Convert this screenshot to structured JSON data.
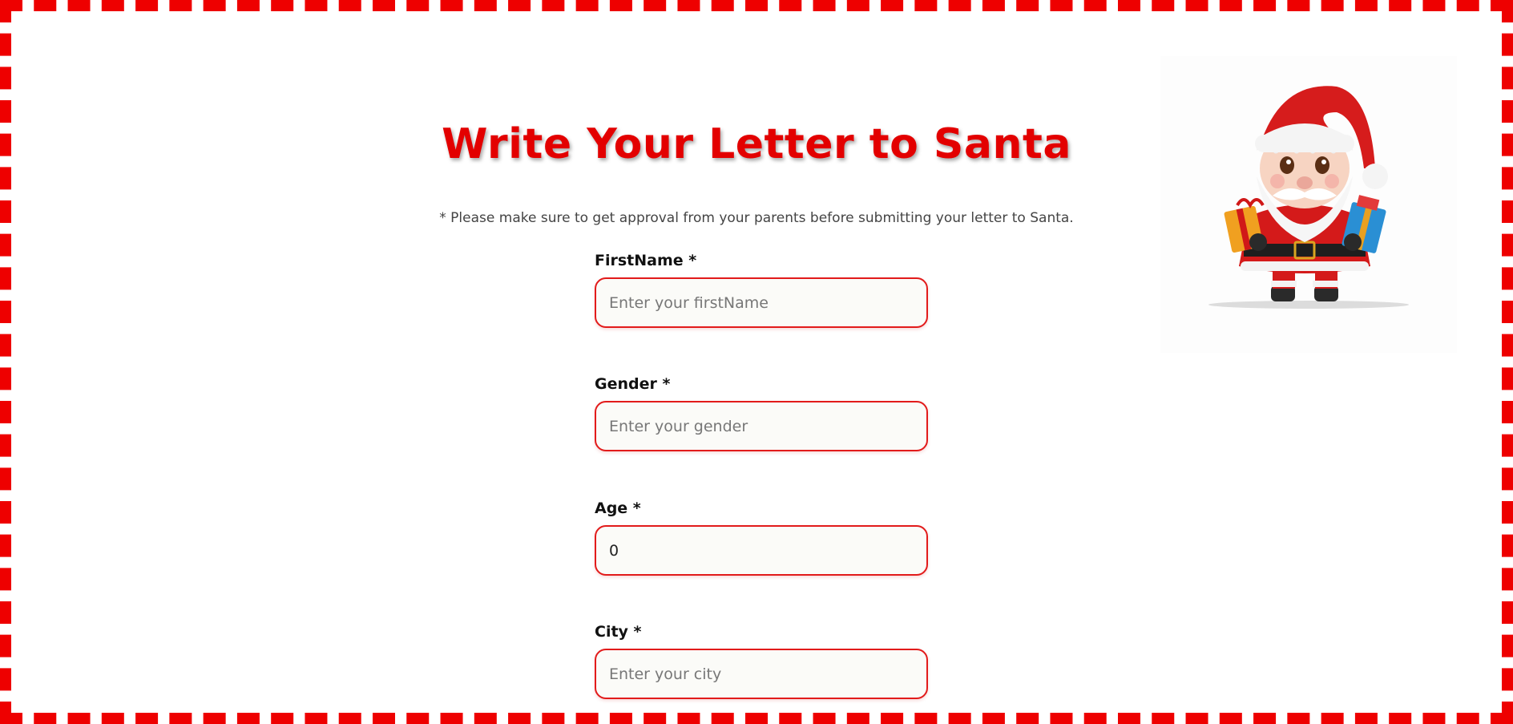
{
  "page": {
    "title": "Write Your Letter to Santa",
    "notice": "* Please make sure to get approval from your parents before submitting your letter to Santa."
  },
  "form": {
    "firstname": {
      "label": "FirstName *",
      "placeholder": "Enter your firstName",
      "value": ""
    },
    "gender": {
      "label": "Gender *",
      "placeholder": "Enter your gender",
      "value": ""
    },
    "age": {
      "label": "Age *",
      "placeholder": "",
      "value": "0"
    },
    "city": {
      "label": "City *",
      "placeholder": "Enter your city",
      "value": ""
    }
  },
  "colors": {
    "border_red": "#ee0000",
    "title_red": "#e30000",
    "input_border": "#e21b1b"
  },
  "illustration": {
    "name": "santa-with-gifts"
  }
}
